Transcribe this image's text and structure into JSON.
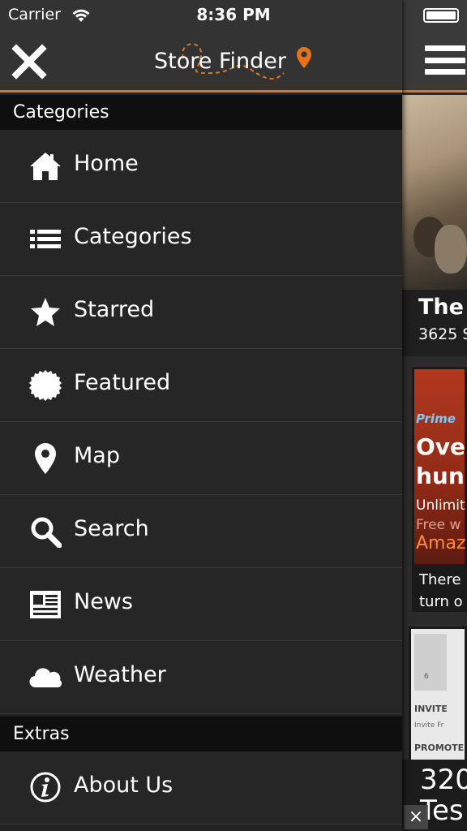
{
  "status_bar": {
    "carrier": "Carrier",
    "time": "8:36 PM"
  },
  "header": {
    "title": "Store Finder",
    "accent_color": "#e8721c"
  },
  "sections": {
    "categories": "Categories",
    "extras": "Extras"
  },
  "menu": [
    {
      "label": "Home",
      "icon": "home-icon"
    },
    {
      "label": "Categories",
      "icon": "list-icon"
    },
    {
      "label": "Starred",
      "icon": "star-icon"
    },
    {
      "label": "Featured",
      "icon": "badge-icon"
    },
    {
      "label": "Map",
      "icon": "map-pin-icon"
    },
    {
      "label": "Search",
      "icon": "search-icon"
    },
    {
      "label": "News",
      "icon": "newspaper-icon"
    },
    {
      "label": "Weather",
      "icon": "cloud-icon"
    }
  ],
  "extras": [
    {
      "label": "About Us",
      "icon": "info-icon"
    }
  ],
  "background_content": {
    "card1_title": "The",
    "card1_subtitle": "3625 S",
    "card2_brand": "Prime",
    "card2_headline_1": "Ove",
    "card2_headline_2": "hun",
    "card2_line_1": "Unlimit",
    "card2_line_2": "Free w",
    "card2_line_3": "Amaz",
    "card2_body_1": "There",
    "card2_body_2": "turn o",
    "card3_line_1": "6",
    "card3_line_2": "INVITE",
    "card3_line_3": "Invite Fr",
    "card3_line_4": "PROMOTE",
    "ad_line_1": "320",
    "ad_line_2": "Tes"
  }
}
